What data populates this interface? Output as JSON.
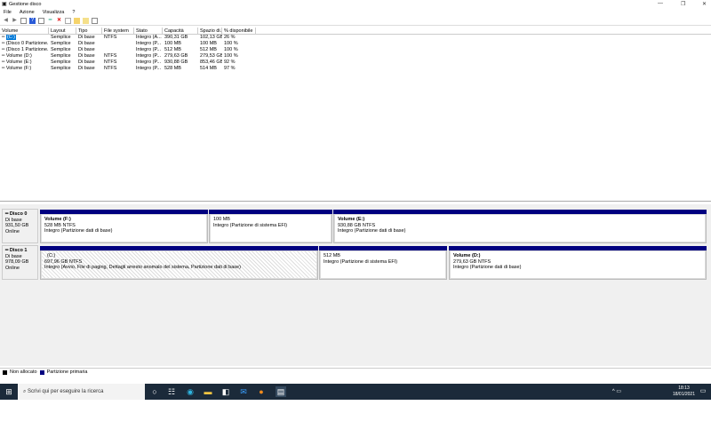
{
  "window": {
    "title": "Gestione disco",
    "minimize": "—",
    "maximize": "❐",
    "close": "✕"
  },
  "menu": [
    "File",
    "Azione",
    "Visualizza",
    "?"
  ],
  "toolbar_icons": [
    "back-icon",
    "forward-icon",
    "list-icon",
    "help-icon",
    "properties-icon",
    "connect-icon",
    "delete-icon",
    "new-icon",
    "folder-icon",
    "search-icon",
    "view-icon"
  ],
  "table": {
    "headers": [
      "Volume",
      "Layout",
      "Tipo",
      "File system",
      "Stato",
      "Capacità",
      "Spazio di...",
      "% disponibile"
    ],
    "rows": [
      [
        "(C:)",
        "Semplice",
        "Di base",
        "NTFS",
        "Integro (A...",
        "390,31 GB",
        "102,13 GB",
        "26 %"
      ],
      [
        "(Disco 0 Partizione...",
        "Semplice",
        "Di base",
        "",
        "Integro (P...",
        "100 MB",
        "100 MB",
        "100 %"
      ],
      [
        "(Disco 1 Partizione...",
        "Semplice",
        "Di base",
        "",
        "Integro (P...",
        "512 MB",
        "512 MB",
        "100 %"
      ],
      [
        "Volume (D:)",
        "Semplice",
        "Di base",
        "NTFS",
        "Integro (P...",
        "279,63 GB",
        "279,53 GB",
        "100 %"
      ],
      [
        "Volume (E:)",
        "Semplice",
        "Di base",
        "NTFS",
        "Integro (P...",
        "930,88 GB",
        "853,46 GB",
        "92 %"
      ],
      [
        "Volume (F:)",
        "Semplice",
        "Di base",
        "NTFS",
        "Integro (P...",
        "528 MB",
        "514 MB",
        "97 %"
      ]
    ]
  },
  "disks": [
    {
      "name": "Disco 0",
      "type": "Di base",
      "size": "931,50 GB",
      "status": "Online",
      "partitions": [
        {
          "title": "Volume  (F:)",
          "size": "528 MB NTFS",
          "status": "Integro (Partizione dati di base)"
        },
        {
          "title": "",
          "size": "100 MB",
          "status": "Integro (Partizione di sistema EFI)"
        },
        {
          "title": "Volume  (E:)",
          "size": "930,88 GB NTFS",
          "status": "Integro (Partizione dati di base)"
        }
      ]
    },
    {
      "name": "Disco 1",
      "type": "Di base",
      "size": "978,09 GB",
      "status": "Online",
      "partitions": [
        {
          "title": "(C:)",
          "size": "697,96 GB NTFS",
          "status": "Integro (Avvio, File di paging, Dettagli arresto anomalo del sistema, Partizione dati di base)"
        },
        {
          "title": "",
          "size": "512 MB",
          "status": "Integro (Partizione di sistema EFI)"
        },
        {
          "title": "Volume  (D:)",
          "size": "279,63 GB NTFS",
          "status": "Integro (Partizione dati di base)"
        }
      ]
    }
  ],
  "legend": [
    {
      "label": "Non allocato",
      "color": "#000000"
    },
    {
      "label": "Partizione primaria",
      "color": "#000080"
    }
  ],
  "taskbar": {
    "search_placeholder": "Scrivi qui per eseguire la ricerca",
    "time": "18:13",
    "date": "18/01/2021"
  }
}
